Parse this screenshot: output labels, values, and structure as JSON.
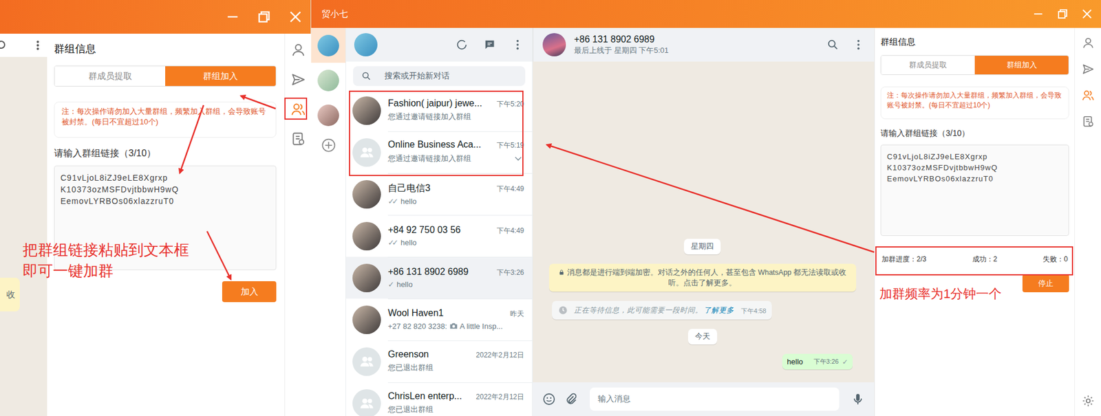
{
  "left_crop": {
    "cut_text": "收",
    "side_icons": [
      {
        "selected": false
      },
      {
        "selected": false
      },
      {
        "selected": true
      },
      {
        "selected": false
      }
    ],
    "panel": {
      "title": "群组信息",
      "tabs": [
        {
          "label": "群成员提取",
          "selected": false
        },
        {
          "label": "群组加入",
          "selected": true
        }
      ],
      "note": "注：每次操作请勿加入大量群组，频繁加入群组，会导致账号被封禁。(每日不宜超过10个)",
      "input_label": "请输入群组链接（3/10）",
      "links": [
        "C91vLjoL8iZJ9eLE8Xgrxp",
        "K10373ozMSFDvjtbbwH9wQ",
        "EemovLYRBOs06xlazzruT0"
      ],
      "button": "加入"
    }
  },
  "window": {
    "title": "贸小七"
  },
  "accounts": [
    {
      "selected": true
    },
    {
      "selected": false
    },
    {
      "selected": false
    }
  ],
  "chat_list": {
    "search_placeholder": "搜索或开始新对话",
    "chats": [
      {
        "name": "Fashion( jaipur) jewe...",
        "time": "下午5:20",
        "preview": "您通过邀请链接加入群组",
        "ticks": "",
        "avatar": "photo",
        "selected": false,
        "hovered": false,
        "media": false
      },
      {
        "name": "Online Business Aca...",
        "time": "下午5:19",
        "preview": "您通过邀请链接加入群组",
        "ticks": "",
        "avatar": "group",
        "selected": false,
        "hovered": true,
        "media": false
      },
      {
        "name": "自己电信3",
        "time": "下午4:49",
        "preview": "hello",
        "ticks": "✓✓",
        "avatar": "photo",
        "selected": false,
        "hovered": false,
        "media": false
      },
      {
        "name": "+84 92 750 03 56",
        "time": "下午4:49",
        "preview": "hello",
        "ticks": "✓✓",
        "avatar": "photo",
        "selected": false,
        "hovered": false,
        "media": false
      },
      {
        "name": "+86 131 8902 6989",
        "time": "下午3:26",
        "preview": "hello",
        "ticks": "✓",
        "avatar": "photo",
        "selected": true,
        "hovered": false,
        "media": false
      },
      {
        "name": "Wool Haven1",
        "time": "昨天",
        "preview": "+27 82 820 3238:",
        "ticks": "",
        "avatar": "photo",
        "selected": false,
        "hovered": false,
        "media": true,
        "media_caption": "A little Insp..."
      },
      {
        "name": "Greenson",
        "time": "2022年2月12日",
        "preview": "您已退出群组",
        "ticks": "",
        "avatar": "group",
        "selected": false,
        "hovered": false,
        "media": false
      },
      {
        "name": "ChrisLen enterp...",
        "time": "2022年2月12日",
        "preview": "您已退出群组",
        "ticks": "",
        "avatar": "group",
        "selected": false,
        "hovered": false,
        "media": false
      }
    ]
  },
  "chat": {
    "name": "+86 131 8902 6989",
    "status": "最后上线于 星期四 下午5:01",
    "messages": [
      {
        "kind": "date",
        "text": "星期四"
      },
      {
        "kind": "notice",
        "text": "消息都是进行端到端加密。对话之外的任何人，甚至包含 WhatsApp 都无法读取或收听。点击了解更多。"
      },
      {
        "kind": "waiting",
        "text": "正在等待信息，此可能需要一段时间。",
        "link": "了解更多",
        "time": "下午4:58"
      },
      {
        "kind": "date",
        "text": "今天"
      },
      {
        "kind": "outgoing",
        "text": "hello",
        "time": "下午3:26",
        "ticks": "✓"
      }
    ],
    "input_placeholder": "输入消息"
  },
  "group_panel": {
    "title": "群组信息",
    "tabs": [
      {
        "label": "群成员提取",
        "selected": false
      },
      {
        "label": "群组加入",
        "selected": true
      }
    ],
    "note": "注：每次操作请勿加入大量群组，频繁加入群组，会导致账号被封禁。(每日不宜超过10个)",
    "input_label": "请输入群组链接（3/10）",
    "links": [
      "C91vLjoL8iZJ9eLE8Xgrxp",
      "K10373ozMSFDvjtbbwH9wQ",
      "EemovLYRBOs06xlazzruT0"
    ],
    "progress": {
      "label": "加群进度：2/3",
      "success": "成功：2",
      "fail": "失败：0"
    },
    "button": "停止"
  },
  "side_icons": [
    {
      "selected": false
    },
    {
      "selected": false
    },
    {
      "selected": true
    },
    {
      "selected": false
    }
  ],
  "annotations": {
    "left_lines": [
      "把群组链接粘贴到文本框",
      "即可一键加群"
    ],
    "right_text": "加群频率为1分钟一个"
  }
}
